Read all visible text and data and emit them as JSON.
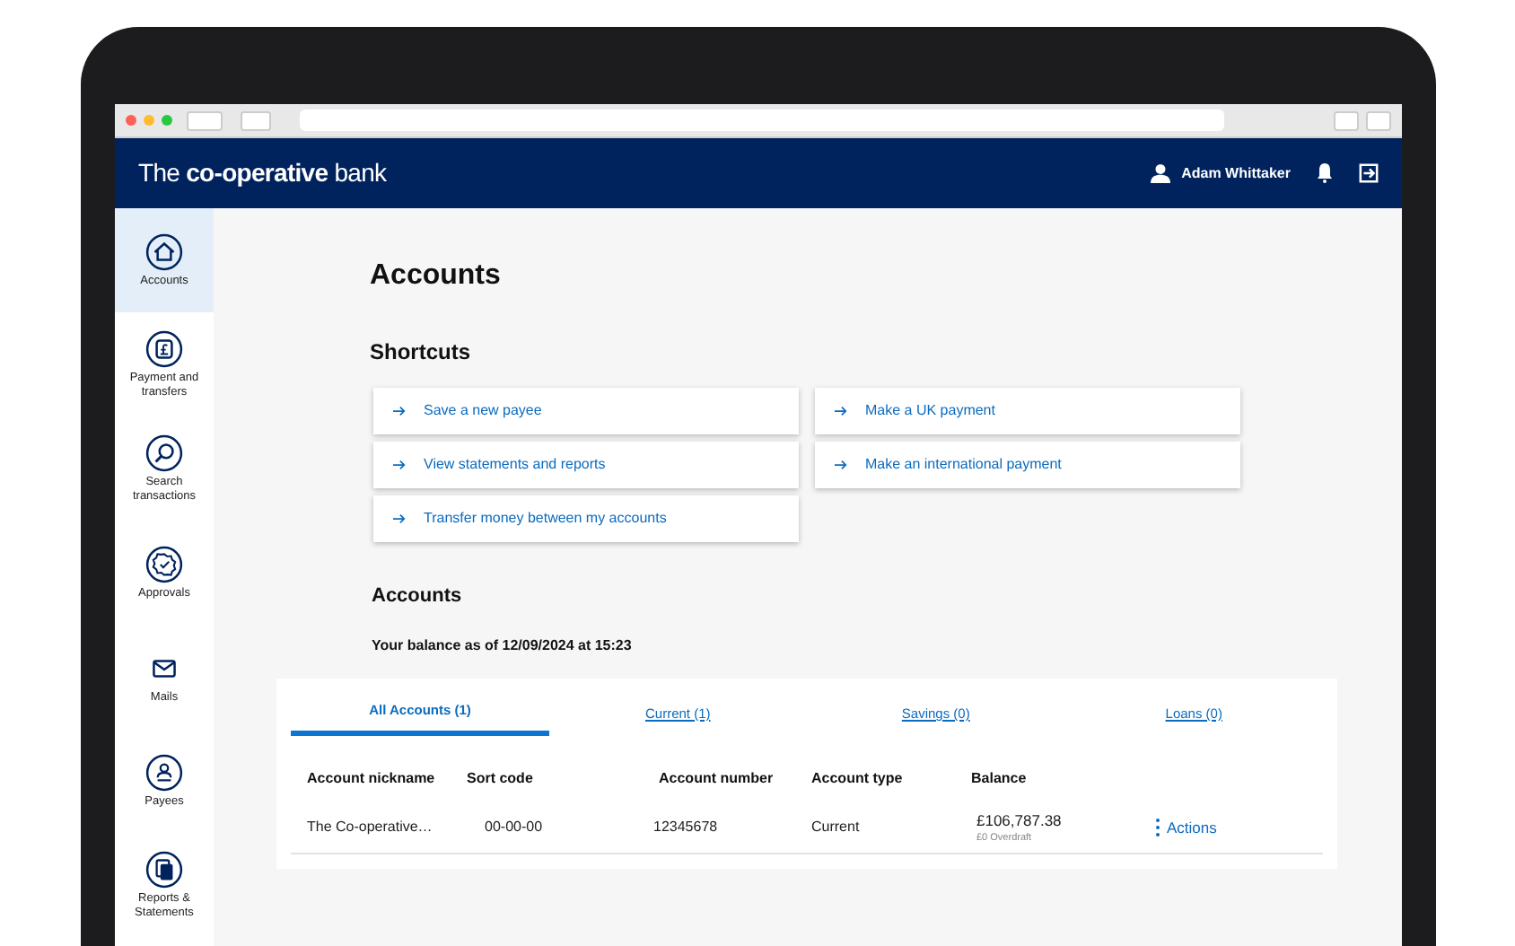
{
  "header": {
    "brand_prefix": "The",
    "brand_bold": "co-operative",
    "brand_suffix": "bank",
    "user_name": "Adam Whittaker"
  },
  "sidebar": {
    "items": [
      {
        "label": "Accounts",
        "selected": true
      },
      {
        "label": "Payment and transfers",
        "selected": false
      },
      {
        "label": "Search transactions",
        "selected": false
      },
      {
        "label": "Approvals",
        "selected": false
      },
      {
        "label": "Mails",
        "selected": false
      },
      {
        "label": "Payees",
        "selected": false
      },
      {
        "label": "Reports & Statements",
        "selected": false
      }
    ]
  },
  "page_title": "Accounts",
  "shortcuts": {
    "title": "Shortcuts",
    "items": [
      {
        "label": "Save a new payee"
      },
      {
        "label": "Make a UK payment"
      },
      {
        "label": "View statements and reports"
      },
      {
        "label": "Make an international payment"
      },
      {
        "label": "Transfer money between my accounts"
      }
    ]
  },
  "accounts": {
    "title": "Accounts",
    "balance_note": "Your balance as of 12/09/2024 at 15:23",
    "tabs": [
      {
        "label": "All Accounts (1)",
        "selected": true
      },
      {
        "label": "Current (1)",
        "selected": false
      },
      {
        "label": "Savings (0)",
        "selected": false
      },
      {
        "label": "Loans (0)",
        "selected": false
      }
    ],
    "columns": [
      "Account nickname",
      "Sort code",
      "Account number",
      "Account type",
      "Balance"
    ],
    "rows": [
      {
        "nickname": "The Co-operative…",
        "sort_code": "00-00-00",
        "account_number": "12345678",
        "account_type": "Current",
        "balance": "£106,787.38",
        "overdraft": "£0 Overdraft",
        "action": "Actions"
      }
    ]
  }
}
